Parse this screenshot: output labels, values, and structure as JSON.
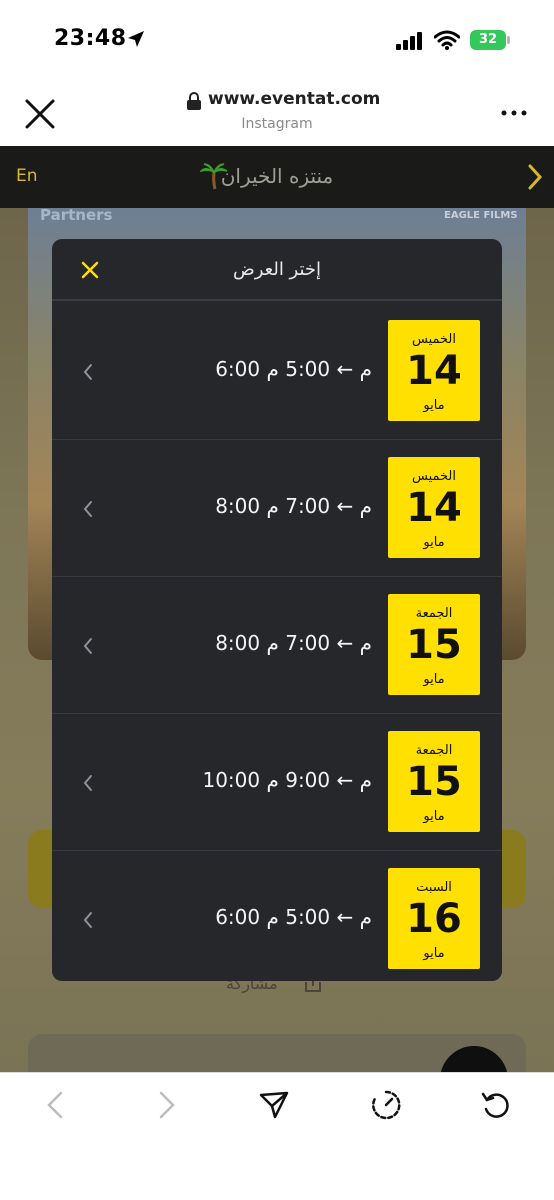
{
  "status_bar": {
    "time": "23:48",
    "battery": "32"
  },
  "browser": {
    "url": "www.eventat.com",
    "source": "Instagram"
  },
  "site": {
    "lang_link": "En",
    "title": "منتزه الخيران"
  },
  "poster": {
    "partners": "Partners",
    "films": "EAGLE FILMS"
  },
  "page": {
    "share": "مشاركة"
  },
  "modal": {
    "title": "إختر العرض",
    "shows": [
      {
        "day_name": "الخميس",
        "day": "14",
        "month": "مايو",
        "time": "6:00 م  ←  5:00 م"
      },
      {
        "day_name": "الخميس",
        "day": "14",
        "month": "مايو",
        "time": "8:00 م  ←  7:00 م"
      },
      {
        "day_name": "الجمعة",
        "day": "15",
        "month": "مايو",
        "time": "8:00 م  ←  7:00 م"
      },
      {
        "day_name": "الجمعة",
        "day": "15",
        "month": "مايو",
        "time": "10:00 م  ←  9:00 م"
      },
      {
        "day_name": "السبت",
        "day": "16",
        "month": "مايو",
        "time": "6:00 م  ←  5:00 م"
      }
    ]
  },
  "colors": {
    "accent": "#ffe000",
    "modal_bg": "#25272a",
    "link": "#d6ba2a"
  },
  "icons": [
    "location-arrow-icon",
    "signal-icon",
    "wifi-icon",
    "close-icon",
    "lock-icon",
    "more-icon",
    "palm-tree-icon",
    "chevron-right-icon",
    "chevron-left-icon",
    "back-icon",
    "forward-icon",
    "share-icon",
    "speed-icon",
    "reload-icon"
  ]
}
